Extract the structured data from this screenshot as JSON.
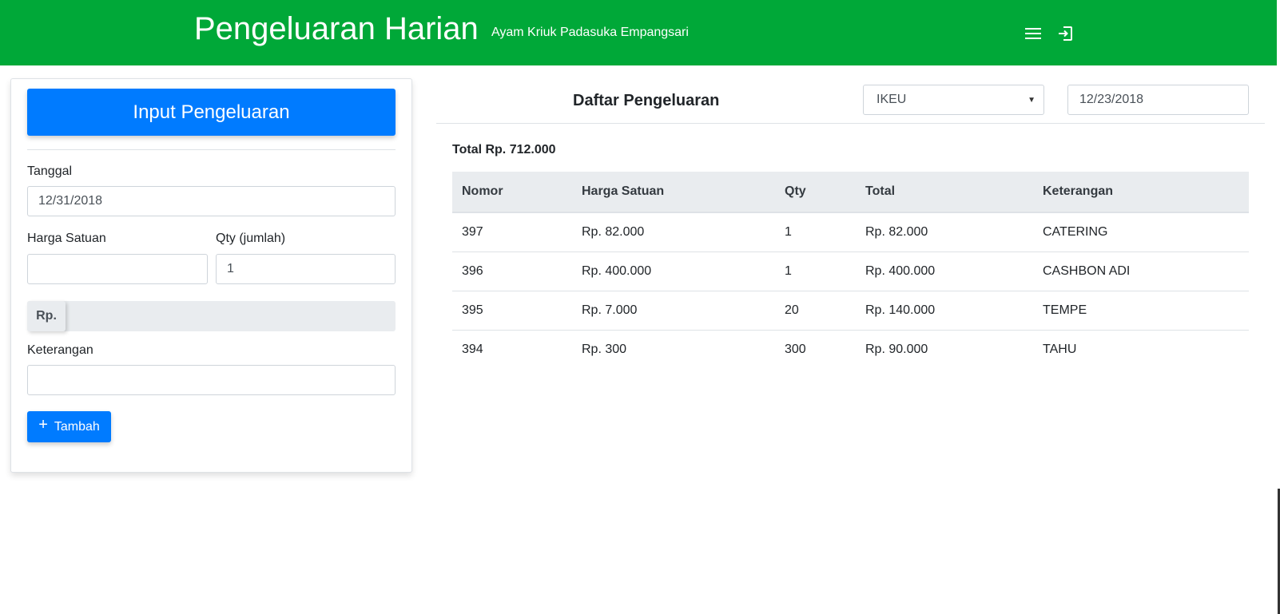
{
  "header": {
    "title": "Pengeluaran Harian",
    "subtitle": "Ayam Kriuk Padasuka Empangsari",
    "menu_icon": "menu-icon",
    "logout_icon": "logout-icon",
    "background_color": "#00a838"
  },
  "form": {
    "heading": "Input Pengeluaran",
    "tanggal_label": "Tanggal",
    "tanggal_value": "12/31/2018",
    "harga_label": "Harga Satuan",
    "harga_value": "",
    "qty_label": "Qty (jumlah)",
    "qty_value": "1",
    "rp_prefix": "Rp.",
    "keterangan_label": "Keterangan",
    "keterangan_value": "",
    "add_icon": "plus-icon",
    "add_label": "Tambah"
  },
  "list": {
    "title": "Daftar Pengeluaran",
    "filter_select": "IKEU",
    "filter_date": "12/23/2018",
    "total": "Total Rp. 712.000",
    "columns": [
      "Nomor",
      "Harga Satuan",
      "Qty",
      "Total",
      "Keterangan"
    ],
    "rows": [
      [
        "397",
        "Rp. 82.000",
        "1",
        "Rp. 82.000",
        "CATERING"
      ],
      [
        "396",
        "Rp. 400.000",
        "1",
        "Rp. 400.000",
        "CASHBON ADI"
      ],
      [
        "395",
        "Rp. 7.000",
        "20",
        "Rp. 140.000",
        "TEMPE"
      ],
      [
        "394",
        "Rp. 300",
        "300",
        "Rp. 90.000",
        "TAHU"
      ]
    ]
  },
  "colors": {
    "primary": "#007bff",
    "header_green": "#00a838"
  }
}
